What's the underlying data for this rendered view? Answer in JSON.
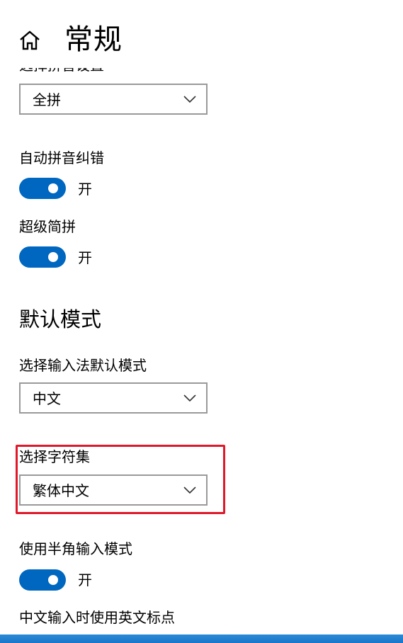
{
  "header": {
    "title": "常规",
    "home_icon": "home-icon"
  },
  "pinyin_settings": {
    "label": "选择拼音设置",
    "value": "全拼"
  },
  "auto_correct": {
    "label": "自动拼音纠错",
    "state": "开"
  },
  "super_jianpin": {
    "label": "超级简拼",
    "state": "开"
  },
  "default_mode": {
    "section_title": "默认模式",
    "input_mode": {
      "label": "选择输入法默认模式",
      "value": "中文"
    },
    "charset": {
      "label": "选择字符集",
      "value": "繁体中文"
    },
    "halfwidth": {
      "label": "使用半角输入模式",
      "state": "开"
    },
    "english_punct": {
      "label": "中文输入时使用英文标点"
    }
  },
  "colors": {
    "accent": "#0067c0",
    "highlight": "#e0182a"
  }
}
